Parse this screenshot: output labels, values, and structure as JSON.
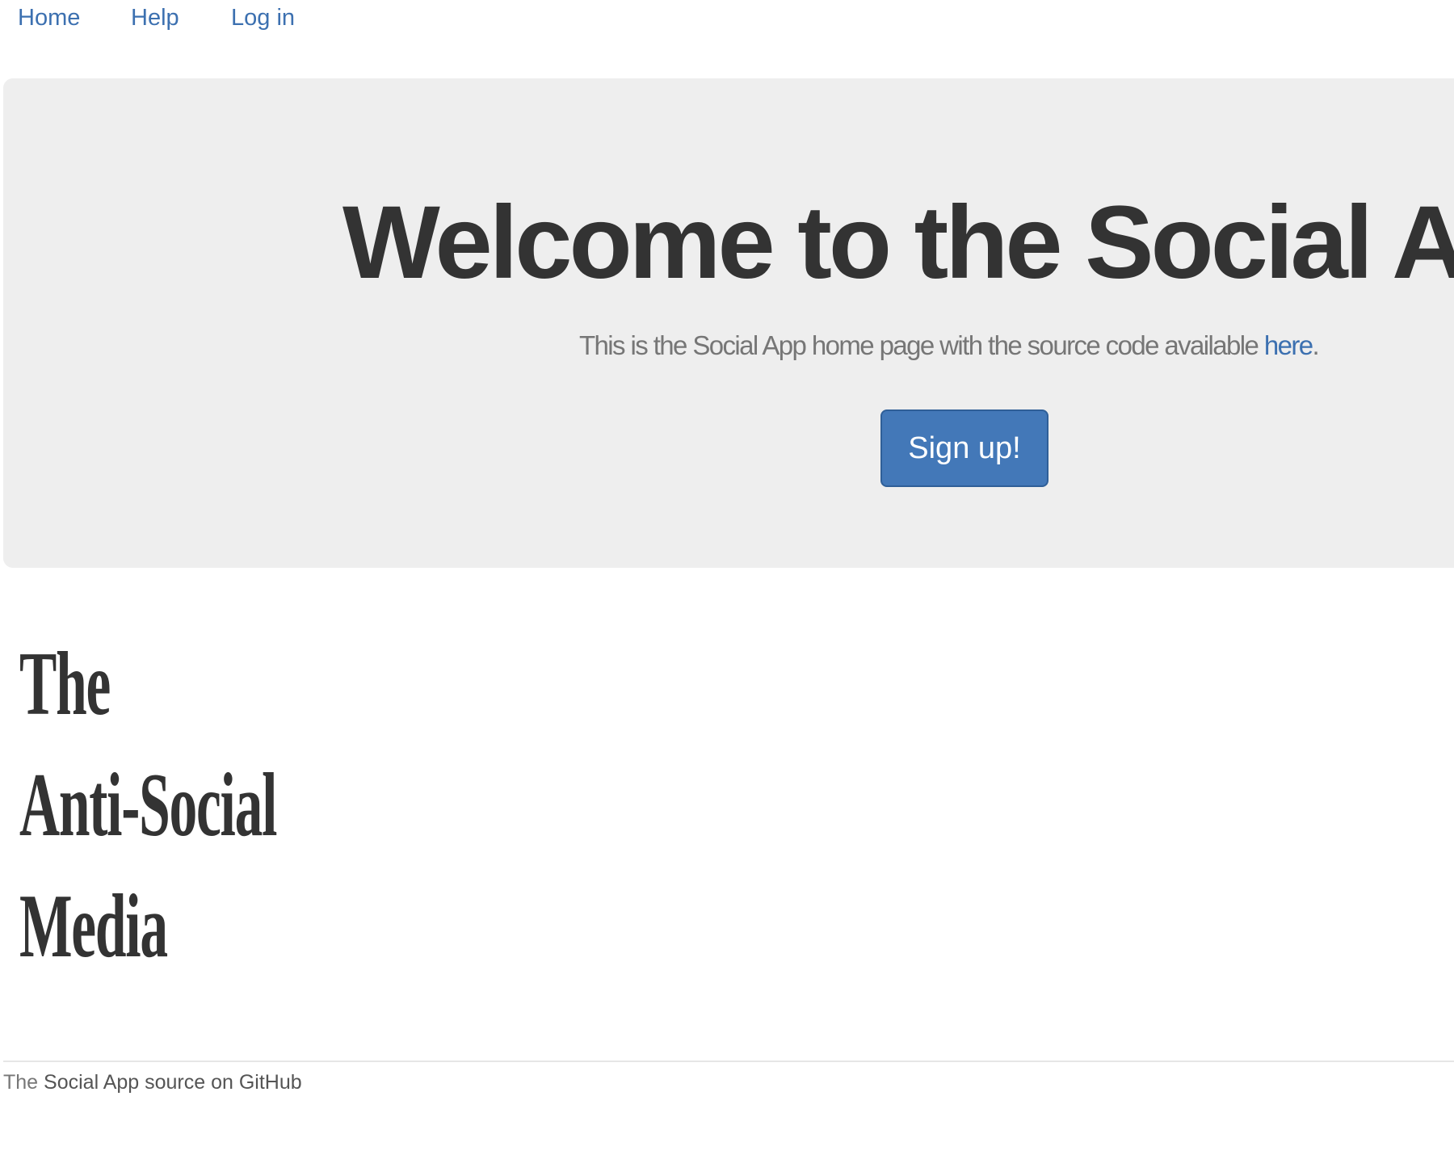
{
  "nav": {
    "items": [
      {
        "label": "Home"
      },
      {
        "label": "Help"
      },
      {
        "label": "Log in"
      }
    ]
  },
  "hero": {
    "title": "Welcome to the Social App",
    "subtitle_text": "This is the Social App home page with the source code available ",
    "subtitle_link": "here",
    "subtitle_end": ".",
    "signup_label": "Sign up!"
  },
  "logo": {
    "lines": [
      "The",
      "Anti-Social",
      "Media"
    ]
  },
  "footer": {
    "prefix": "The ",
    "link": "Social App source on GitHub"
  },
  "colors": {
    "link": "#3c70b0",
    "button": "#4378b8",
    "jumbotron_bg": "#eeeeee"
  }
}
